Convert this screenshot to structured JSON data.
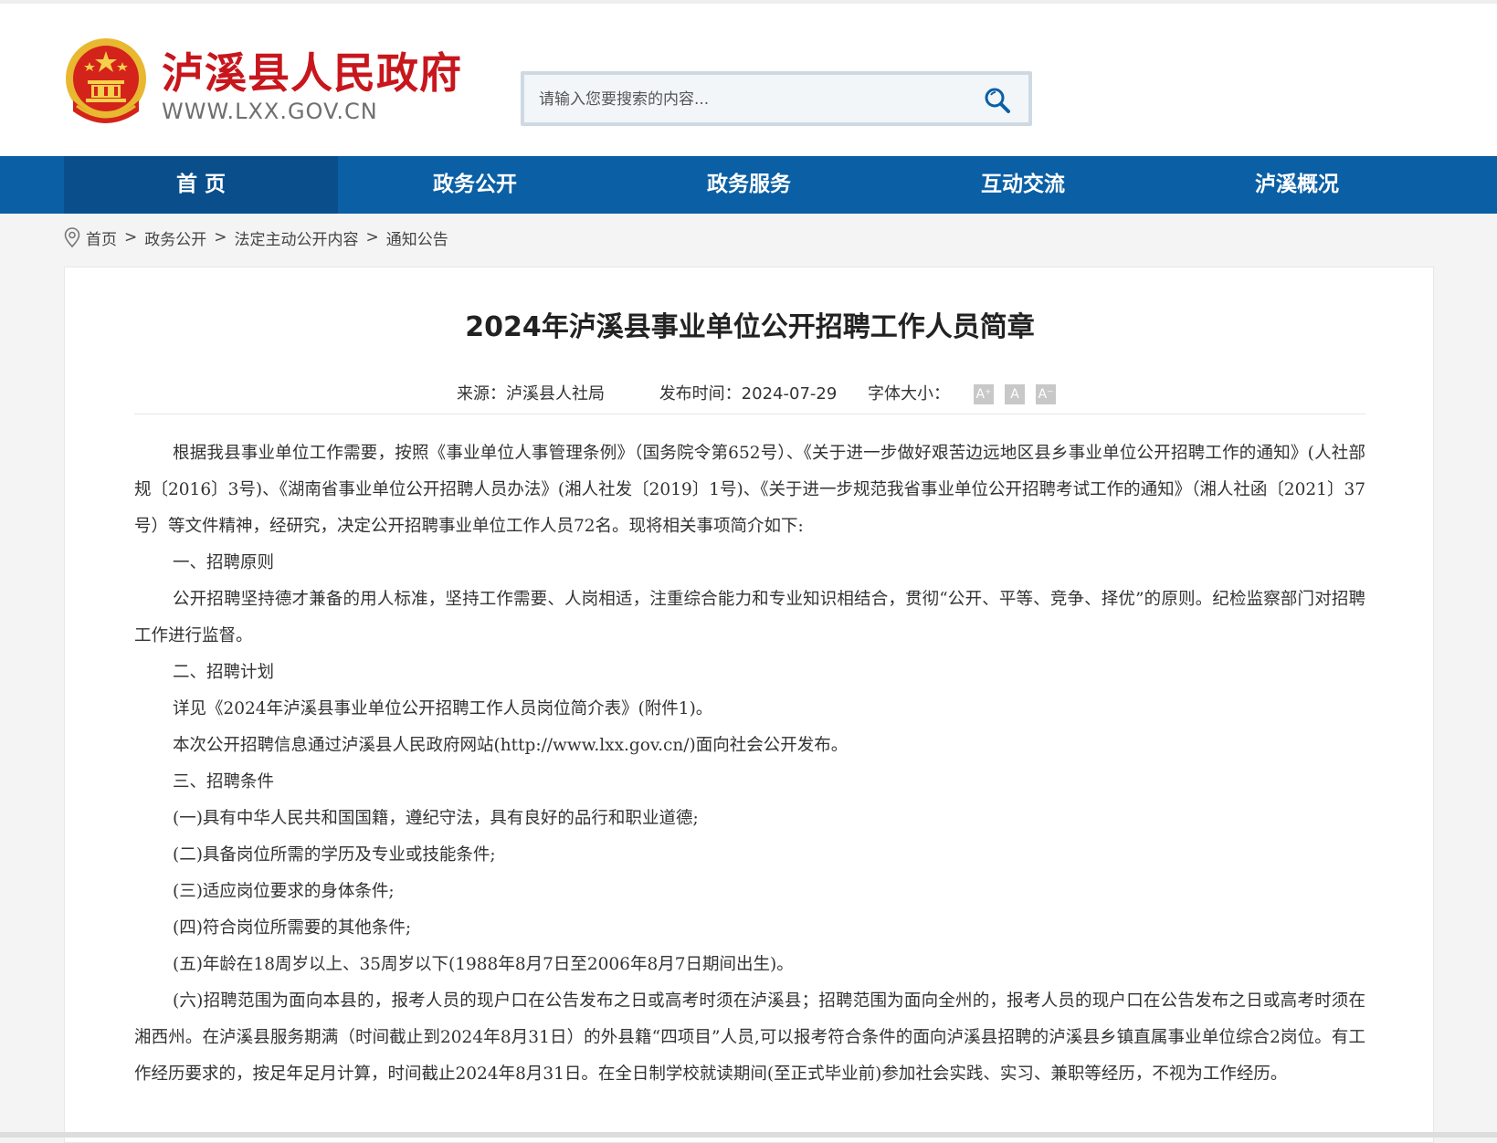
{
  "header": {
    "site_title": "泸溪县人民政府",
    "site_url": "WWW.LXX.GOV.CN",
    "search_placeholder": "请输入您要搜索的内容..."
  },
  "nav": {
    "items": [
      {
        "label": "首 页",
        "active": true
      },
      {
        "label": "政务公开",
        "active": false
      },
      {
        "label": "政务服务",
        "active": false
      },
      {
        "label": "互动交流",
        "active": false
      },
      {
        "label": "泸溪概况",
        "active": false
      }
    ]
  },
  "breadcrumb": [
    "首页",
    "政务公开",
    "法定主动公开内容",
    "通知公告"
  ],
  "article": {
    "title": "2024年泸溪县事业单位公开招聘工作人员简章",
    "source": "来源：泸溪县人社局",
    "publish_time": "发布时间：2024-07-29",
    "font_size_label": "字体大小：",
    "font_buttons": [
      "A⁺",
      "A",
      "A⁻"
    ],
    "paragraphs": [
      "根据我县事业单位工作需要，按照《事业单位人事管理条例》（国务院令第652号）、《关于进一步做好艰苦边远地区县乡事业单位公开招聘工作的通知》(人社部规〔2016〕3号)、《湖南省事业单位公开招聘人员办法》(湘人社发〔2019〕1号)、《关于进一步规范我省事业单位公开招聘考试工作的通知》（湘人社函〔2021〕37号）等文件精神，经研究，决定公开招聘事业单位工作人员72名。现将相关事项简介如下:",
      "一、招聘原则",
      "公开招聘坚持德才兼备的用人标准，坚持工作需要、人岗相适，注重综合能力和专业知识相结合，贯彻“公开、平等、竞争、择优”的原则。纪检监察部门对招聘工作进行监督。",
      "二、招聘计划",
      "详见《2024年泸溪县事业单位公开招聘工作人员岗位简介表》(附件1)。",
      "本次公开招聘信息通过泸溪县人民政府网站(http://www.lxx.gov.cn/)面向社会公开发布。",
      "三、招聘条件",
      "(一)具有中华人民共和国国籍，遵纪守法，具有良好的品行和职业道德;",
      "(二)具备岗位所需的学历及专业或技能条件;",
      "(三)适应岗位要求的身体条件;",
      "(四)符合岗位所需要的其他条件;",
      "(五)年龄在18周岁以上、35周岁以下(1988年8月7日至2006年8月7日期间出生)。",
      "(六)招聘范围为面向本县的，报考人员的现户口在公告发布之日或高考时须在泸溪县；招聘范围为面向全州的，报考人员的现户口在公告发布之日或高考时须在湘西州。在泸溪县服务期满（时间截止到2024年8月31日）的外县籍“四项目”人员,可以报考符合条件的面向泸溪县招聘的泸溪县乡镇直属事业单位综合2岗位。有工作经历要求的，按足年足月计算，时间截止2024年8月31日。在全日制学校就读期间(至正式毕业前)参加社会实践、实习、兼职等经历，不视为工作经历。"
    ]
  },
  "colors": {
    "brand_red": "#c8161d",
    "nav_blue": "#0a5fa5",
    "nav_active": "#0a4f8c"
  }
}
